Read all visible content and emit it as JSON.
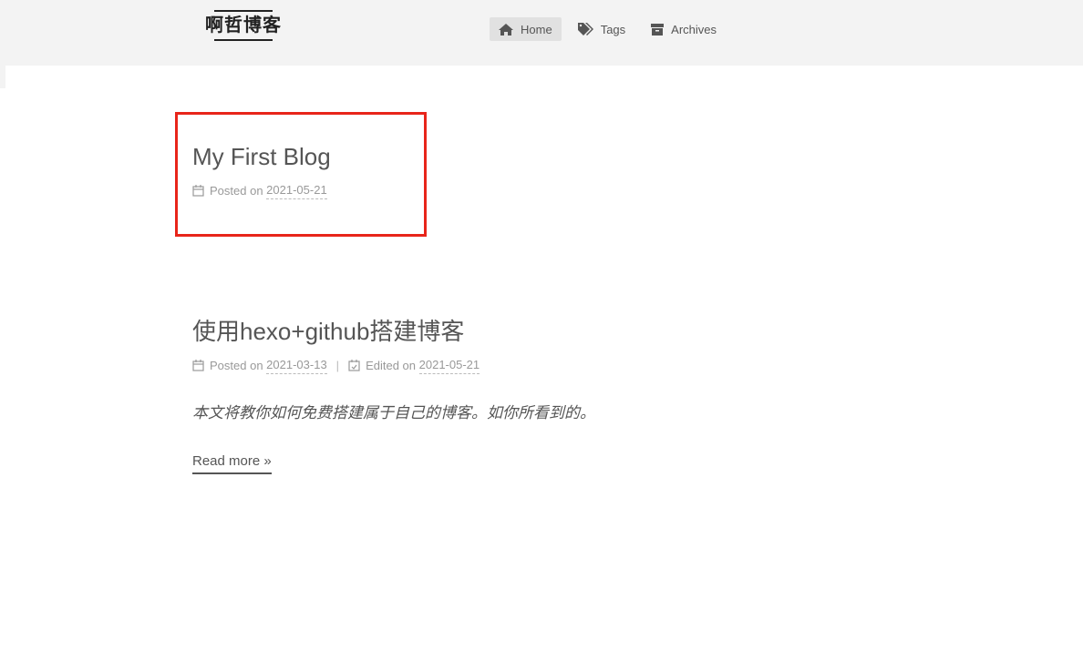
{
  "site": {
    "title": "啊哲博客"
  },
  "menu": [
    {
      "label": "Home",
      "icon": "home-icon",
      "active": true
    },
    {
      "label": "Tags",
      "icon": "tags-icon",
      "active": false
    },
    {
      "label": "Archives",
      "icon": "archive-icon",
      "active": false
    }
  ],
  "posts": [
    {
      "title": "My First Blog",
      "posted_label": "Posted on",
      "posted_date": "2021-05-21"
    },
    {
      "title": "使用hexo+github搭建博客",
      "posted_label": "Posted on",
      "posted_date": "2021-03-13",
      "separator": "|",
      "edited_label": "Edited on",
      "edited_date": "2021-05-21",
      "excerpt": "本文将教你如何免费搭建属于自己的博客。如你所看到的。",
      "read_more": "Read more »"
    }
  ],
  "colors": {
    "highlight": "#e8251a",
    "header_bg": "#f3f3f3",
    "active_menu_bg": "#e1e1e1"
  }
}
